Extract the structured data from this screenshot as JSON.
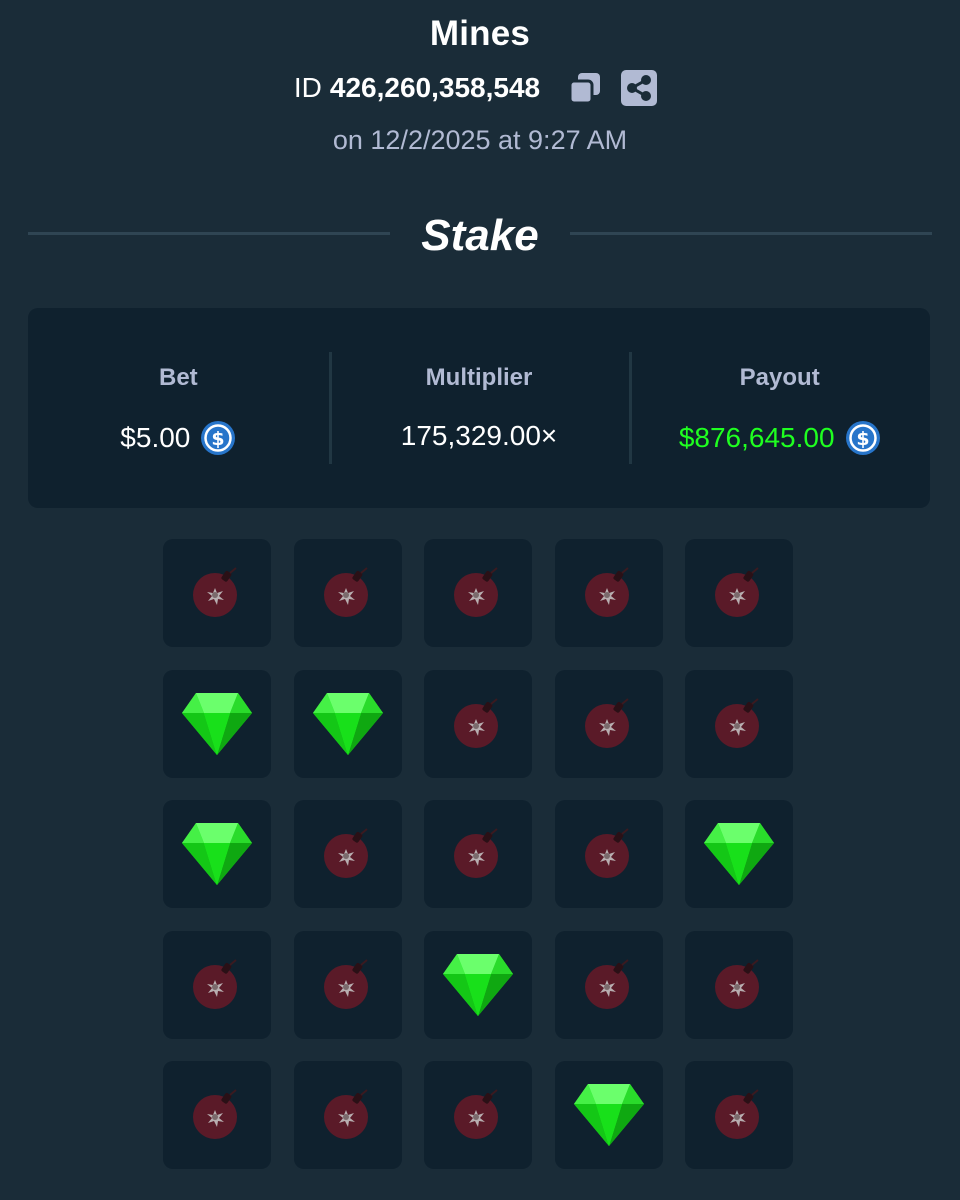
{
  "header": {
    "title": "Mines",
    "id_prefix": "ID",
    "id_number": "426,260,358,548",
    "date": "on 12/2/2025 at 9:27 AM",
    "brand": "Stake"
  },
  "stats": {
    "bet": {
      "label": "Bet",
      "value": "$5.00",
      "currency_icon": "usdc-coin-icon"
    },
    "multiplier": {
      "label": "Multiplier",
      "value": "175,329.00×"
    },
    "payout": {
      "label": "Payout",
      "value": "$876,645.00",
      "currency_icon": "usdc-coin-icon"
    }
  },
  "colors": {
    "background": "#1a2c38",
    "card": "#0f212e",
    "payout_green": "#1fff20",
    "muted_text": "#b1bad3",
    "coin_blue": "#2775ca"
  },
  "board": {
    "rows": 5,
    "cols": 5,
    "tiles": [
      "mine",
      "mine",
      "mine",
      "mine",
      "mine",
      "gem",
      "gem",
      "mine",
      "mine",
      "mine",
      "gem",
      "mine",
      "mine",
      "mine",
      "gem",
      "mine",
      "mine",
      "gem",
      "mine",
      "mine",
      "mine",
      "mine",
      "mine",
      "gem",
      "mine"
    ]
  }
}
